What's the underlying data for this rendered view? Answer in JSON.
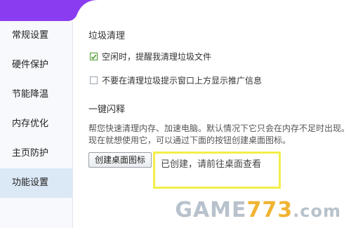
{
  "sidebar": {
    "items": [
      {
        "label": "常规设置"
      },
      {
        "label": "硬件保护"
      },
      {
        "label": "节能降温"
      },
      {
        "label": "内存优化"
      },
      {
        "label": "主页防护"
      },
      {
        "label": "功能设置",
        "active": true
      }
    ]
  },
  "junk_cleanup": {
    "title": "垃圾清理",
    "option_idle": {
      "label": "空闲时，提醒我清理垃圾文件",
      "checked": true
    },
    "option_no_promo": {
      "label": "不要在清理垃圾提示窗口上方显示推广信息",
      "checked": false
    }
  },
  "one_click_boost": {
    "title": "一键闪释",
    "desc_line1": "帮您快速清理内存、加速电脑。默认情况下它只会在内存不足时出现。",
    "desc_line2": "现在就想使用它，可以通过下面的按钮创建桌面图标。",
    "create_button": "创建桌面图标",
    "status_text": "已创建，请前往桌面查看"
  },
  "watermark": {
    "text_game": "GAME",
    "text_num": "773",
    "text_com": ".com"
  },
  "colors": {
    "accent_purple": "#8a3df0",
    "highlight_yellow": "#f2ee48",
    "active_bg": "#dbe8f6",
    "check_green": "#4c9a2a"
  }
}
